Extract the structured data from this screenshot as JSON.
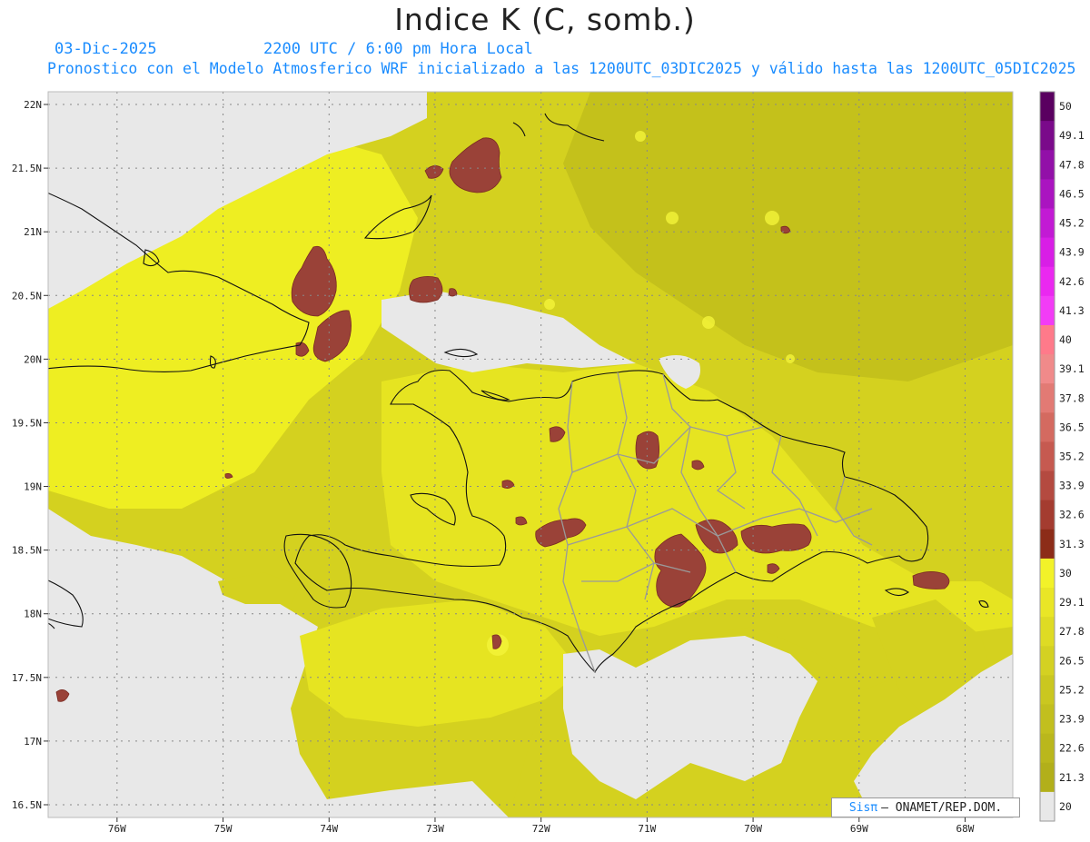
{
  "title": "Indice K (C, somb.)",
  "subtitle": {
    "date": "03-Dic-2025",
    "time": "2200 UTC / 6:00 pm Hora Local",
    "info": "Pronostico con el Modelo Atmosferico WRF inicializado a las 1200UTC_03DIC2025 y válido hasta las  1200UTC_05DIC2025"
  },
  "map": {
    "lon_range": [
      -76.65,
      -67.55
    ],
    "lat_range": [
      16.4,
      22.1
    ],
    "lat_labels": [
      "22N",
      "21.5N",
      "21N",
      "20.5N",
      "20N",
      "19.5N",
      "19N",
      "18.5N",
      "18N",
      "17.5N",
      "17N",
      "16.5N"
    ],
    "lon_labels": [
      "76W",
      "75W",
      "74W",
      "73W",
      "72W",
      "71W",
      "70W",
      "69W",
      "68W"
    ],
    "grid": true,
    "no_data_color": "#e8e8e8",
    "field_colors": [
      "#c4c11b",
      "#d4d11f",
      "#e6e421",
      "#eeee22"
    ],
    "high_k_color": "#9a4238"
  },
  "colorbar": {
    "labels": [
      "50",
      "49.1",
      "47.8",
      "46.5",
      "45.2",
      "43.9",
      "42.6",
      "41.3",
      "40",
      "39.1",
      "37.8",
      "36.5",
      "35.2",
      "33.9",
      "32.6",
      "31.3",
      "30",
      "29.1",
      "27.8",
      "26.5",
      "25.2",
      "23.9",
      "22.6",
      "21.3",
      "20"
    ],
    "colors": [
      "#5a0060",
      "#7a0a8a",
      "#9210a8",
      "#aa14c0",
      "#c21ad4",
      "#d81ee6",
      "#ea28f0",
      "#f23cf6",
      "#ff7a8a",
      "#f08a8a",
      "#e27a74",
      "#d46a60",
      "#c65a50",
      "#b44a40",
      "#a43c30",
      "#8c2c18",
      "#f2f229",
      "#e9e626",
      "#dedb24",
      "#d4d122",
      "#cac720",
      "#c2bf1e",
      "#bab71c",
      "#b2af1a",
      "#e8e8e8"
    ]
  },
  "credit": {
    "logo": "Sisπ",
    "text": "– ONAMET/REP.DOM."
  }
}
